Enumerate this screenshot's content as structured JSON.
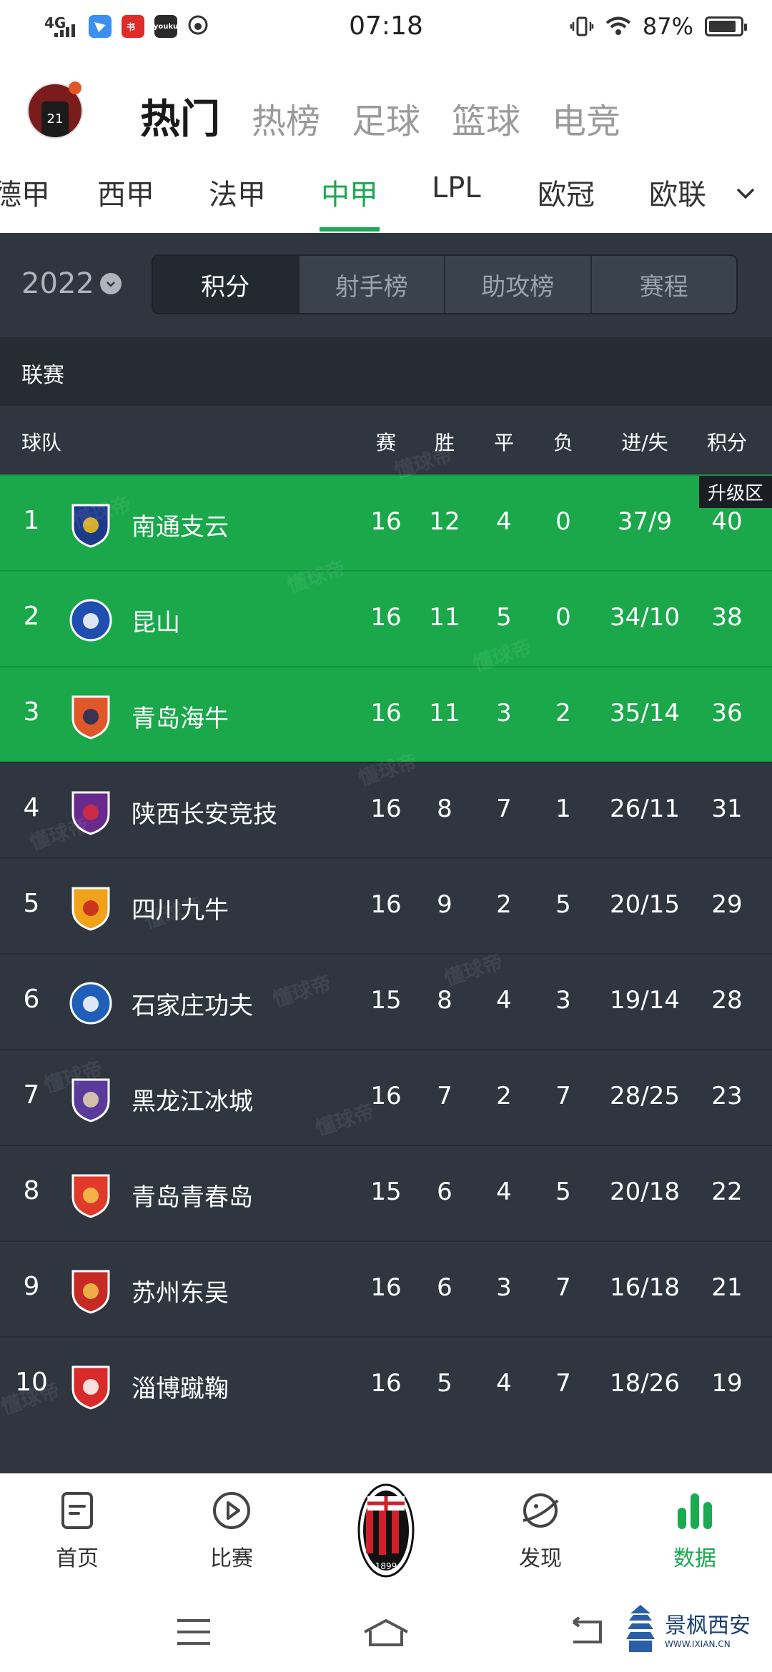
{
  "status_bar": {
    "network": "4G",
    "apps": [
      {
        "name": "feishu-icon",
        "color": "#3b8ff0",
        "text": ""
      },
      {
        "name": "xiaohongshu-icon",
        "color": "#e02b2b",
        "text": ""
      },
      {
        "name": "youku-icon",
        "color": "#2a2a2a",
        "text": "youku"
      }
    ],
    "time": "07:18",
    "battery_percent": "87%",
    "battery_level": 0.87
  },
  "top_nav": {
    "tabs": [
      {
        "label": "热门",
        "active": true
      },
      {
        "label": "热榜",
        "active": false
      },
      {
        "label": "足球",
        "active": false
      },
      {
        "label": "篮球",
        "active": false
      },
      {
        "label": "电竞",
        "active": false
      }
    ]
  },
  "league_tabs": [
    {
      "label": "德甲",
      "active": false
    },
    {
      "label": "西甲",
      "active": false
    },
    {
      "label": "法甲",
      "active": false
    },
    {
      "label": "中甲",
      "active": true
    },
    {
      "label": "LPL",
      "active": false
    },
    {
      "label": "欧冠",
      "active": false
    },
    {
      "label": "欧联",
      "active": false
    }
  ],
  "standings": {
    "season": "2022",
    "segments": [
      {
        "label": "积分",
        "active": true
      },
      {
        "label": "射手榜",
        "active": false
      },
      {
        "label": "助攻榜",
        "active": false
      },
      {
        "label": "赛程",
        "active": false
      }
    ],
    "section_title": "联赛",
    "headers": {
      "team": "球队",
      "played": "赛",
      "won": "胜",
      "drawn": "平",
      "lost": "负",
      "goals": "进/失",
      "points": "积分"
    },
    "promotion_label": "升级区",
    "rows": [
      {
        "rank": "1",
        "team": "南通支云",
        "p": "16",
        "w": "12",
        "d": "4",
        "l": "0",
        "g": "37/9",
        "pts": "40",
        "promo": true,
        "logo_color": "#1d3a8a",
        "logo_accent": "#f4c21a"
      },
      {
        "rank": "2",
        "team": "昆山",
        "p": "16",
        "w": "11",
        "d": "5",
        "l": "0",
        "g": "34/10",
        "pts": "38",
        "promo": true,
        "logo_color": "#1f4db0",
        "logo_accent": "#ffffff"
      },
      {
        "rank": "3",
        "team": "青岛海牛",
        "p": "16",
        "w": "11",
        "d": "3",
        "l": "2",
        "g": "35/14",
        "pts": "36",
        "promo": true,
        "logo_color": "#e0582a",
        "logo_accent": "#1c2d5a"
      },
      {
        "rank": "4",
        "team": "陕西长安竞技",
        "p": "16",
        "w": "8",
        "d": "7",
        "l": "1",
        "g": "26/11",
        "pts": "31",
        "promo": false,
        "logo_color": "#6a2a8c",
        "logo_accent": "#d92b3a"
      },
      {
        "rank": "5",
        "team": "四川九牛",
        "p": "16",
        "w": "9",
        "d": "2",
        "l": "5",
        "g": "20/15",
        "pts": "29",
        "promo": false,
        "logo_color": "#f0a21a",
        "logo_accent": "#c5221f"
      },
      {
        "rank": "6",
        "team": "石家庄功夫",
        "p": "15",
        "w": "8",
        "d": "4",
        "l": "3",
        "g": "19/14",
        "pts": "28",
        "promo": false,
        "logo_color": "#1f5fb8",
        "logo_accent": "#ffffff"
      },
      {
        "rank": "7",
        "team": "黑龙江冰城",
        "p": "16",
        "w": "7",
        "d": "2",
        "l": "7",
        "g": "28/25",
        "pts": "23",
        "promo": false,
        "logo_color": "#5a3a9a",
        "logo_accent": "#e8d8b0"
      },
      {
        "rank": "8",
        "team": "青岛青春岛",
        "p": "15",
        "w": "6",
        "d": "4",
        "l": "5",
        "g": "20/18",
        "pts": "22",
        "promo": false,
        "logo_color": "#e03a2a",
        "logo_accent": "#f5c84a"
      },
      {
        "rank": "9",
        "team": "苏州东吴",
        "p": "16",
        "w": "6",
        "d": "3",
        "l": "7",
        "g": "16/18",
        "pts": "21",
        "promo": false,
        "logo_color": "#c52a24",
        "logo_accent": "#f2c64a"
      },
      {
        "rank": "10",
        "team": "淄博蹴鞠",
        "p": "16",
        "w": "5",
        "d": "4",
        "l": "7",
        "g": "18/26",
        "pts": "19",
        "promo": false,
        "logo_color": "#d92b2b",
        "logo_accent": "#ffffff"
      }
    ]
  },
  "watermark_text": "懂球帝",
  "bottom_nav": [
    {
      "label": "首页",
      "icon": "home-doc-icon",
      "active": false
    },
    {
      "label": "比赛",
      "icon": "play-icon",
      "active": false
    },
    {
      "label": "",
      "icon": "ac-milan-logo",
      "active": false
    },
    {
      "label": "发现",
      "icon": "planet-icon",
      "active": false
    },
    {
      "label": "数据",
      "icon": "bar-chart-icon",
      "active": true
    }
  ],
  "brand_watermark": {
    "main": "景枫西安",
    "url": "WWW.IXIAN.CN"
  },
  "colors": {
    "accent": "#1aaa52",
    "panel": "#2f3640",
    "promo": "#1aa84b"
  }
}
